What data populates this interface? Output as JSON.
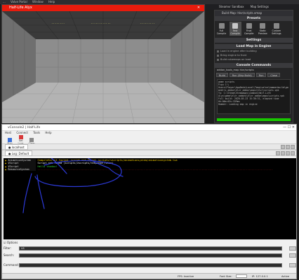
{
  "top_strip": {
    "items": [
      "...",
      "Valve Portal",
      "Window",
      "Help"
    ]
  },
  "game_window": {
    "title": "Half-Life Alyx",
    "close": "✕",
    "hud_text": [
      "........",
      "............",
      "........."
    ]
  },
  "right_taskbar": {
    "items": [
      "Steamvr Sandbox",
      "Map Settings"
    ]
  },
  "launcher": {
    "title": "Build Map: hlvr/scripts.vmap",
    "presets_header": "Presets",
    "presets": [
      {
        "label": "Full Compile"
      },
      {
        "label": "Fast Compile"
      },
      {
        "label": "Final Compile"
      },
      {
        "label": "Static Preview"
      },
      {
        "label": "Custom Settings"
      }
    ],
    "selected_preset_index": 1,
    "settings_header": "Settings",
    "load_header": "Load Map in Engine",
    "options": [
      "Load in engine after building",
      "Bring engine to front",
      "Build cubemaps on load"
    ],
    "console_header": "Console Commands",
    "console_cmd": "addon_tools_map hlvr/scripts",
    "buttons": [
      "Build",
      "Run (Skip Build)",
      "Run",
      "Close"
    ],
    "log_lines": [
      "game scripts",
      "Fcpu C:\\",
      "Users\\Player\\AppData\\Local\\Temp\\valve\\hammerbuild\\ga",
      "meblls_addon\\hlvr_addon\\maps\\hlvr\\scripts.vpk",
      "To: C:\\Steam\\Steamapps\\common\\Half-Life",
      "Alyx\\game\\hlvr_addons\\hlvr_addon\\maps\\scripts.vpk",
      "Full build: 2020-03-23 15:36:31, elapsed time",
      "0h:00m:03s:339ms",
      "Hammer: Loading map in engine"
    ],
    "progress": 1.0
  },
  "console_window": {
    "title": "vConsole2 | Half-Life",
    "window_controls": "—  ☐  ✕",
    "menu": [
      "Host",
      "Connect",
      "Tools",
      "Help"
    ],
    "toolbar": [
      "Map",
      "Set Logs",
      "Clear"
    ],
    "tab_connection": "localhost",
    "tab_log": "Log: Default",
    "log": [
      {
        "cat": "AnimationSystem",
        "text": "CompileScript failed, script not found: scripts/vscripts/animationsystem/animationsystem.lua",
        "color": "yellow"
      },
      {
        "cat": "VScript",
        "text": "Script not found (scripts/vscripts/response_rules)",
        "color": "white"
      },
      {
        "cat": "VScript",
        "text": "Hello Voodoo!",
        "color": "green"
      },
      {
        "cat": "ResourceSystem",
        "text": "...........................................................................................................................................................",
        "color": "red"
      }
    ],
    "options_label": "Options",
    "filter_label": "Filter:",
    "filter_value": "VS",
    "search_label": "Search:",
    "search_value": "",
    "command_label": "Command:",
    "command_value": "",
    "status": {
      "fps": "FPS: Inactive",
      "font_size": "Font Size:",
      "ip": "IP: 127.0.0.1",
      "state": "Active"
    }
  }
}
